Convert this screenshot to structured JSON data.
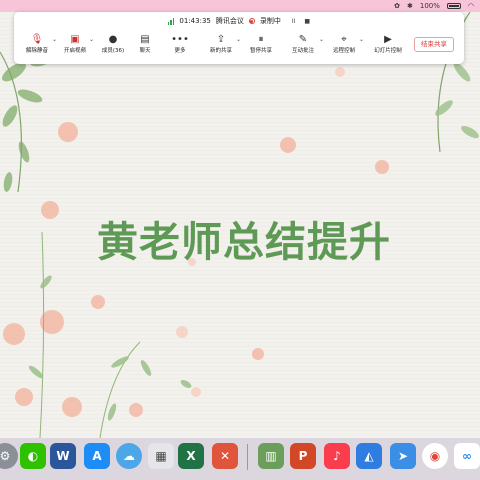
{
  "menubar": {
    "battery": "100%"
  },
  "meeting": {
    "elapsed_time": "01:43:35",
    "app_title": "腾讯会议",
    "recording_label": "录制中",
    "pause_symbol": "II",
    "stop_symbol": "■",
    "buttons": {
      "unmute": "解除静音",
      "video": "开启视频",
      "members": "成员(36)",
      "chat": "聊天",
      "more": "更多",
      "new_share": "新的共享",
      "pause_share": "暂停共享",
      "annotate": "互动批注",
      "remote_control": "远程控制",
      "slideshow_control": "幻灯片控制",
      "end_share": "结束共享"
    }
  },
  "slide": {
    "title": "黄老师总结提升"
  },
  "dock": {
    "apps": [
      "System Preferences",
      "WeChat",
      "Word",
      "App Store",
      "Lark",
      "Launchpad",
      "Excel",
      "Xmind",
      "Books",
      "PowerPoint",
      "Music",
      "Tencent Meeting",
      "Feishu",
      "Chrome",
      "Baidu Netdisk"
    ],
    "word_letter": "W",
    "excel_letter": "X",
    "ppt_letter": "P"
  }
}
